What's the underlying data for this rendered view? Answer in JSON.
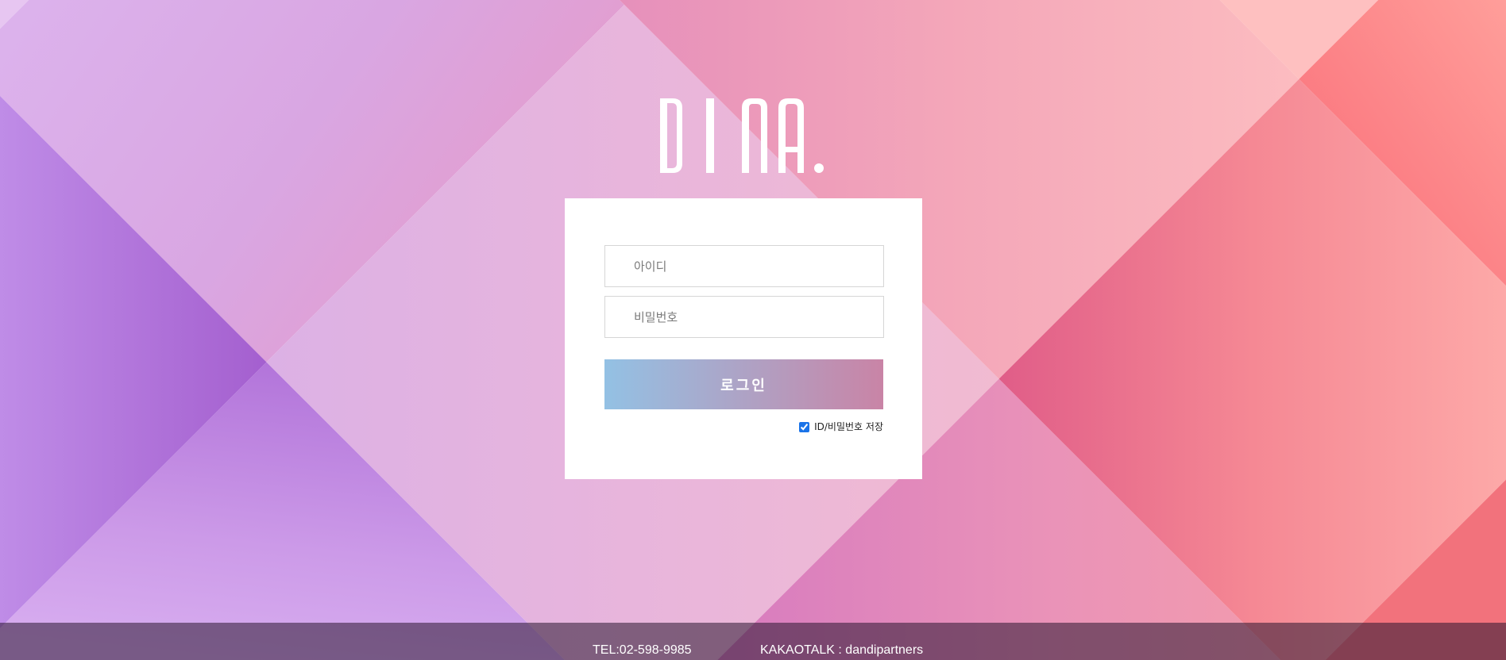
{
  "logo": {
    "text": "DINA."
  },
  "login": {
    "id_placeholder": "아이디",
    "password_placeholder": "비밀번호",
    "submit_label": "로그인",
    "remember_label": "ID/비밀번호 저장",
    "remember_checked": true
  },
  "footer": {
    "tel": "TEL:02-598-9985",
    "kakao": "KAKAOTALK : dandipartners"
  },
  "colors": {
    "button_gradient_start": "#93c1e4",
    "button_gradient_end": "#c984a6",
    "card_background": "#ffffff",
    "footer_text": "#ffffff"
  }
}
